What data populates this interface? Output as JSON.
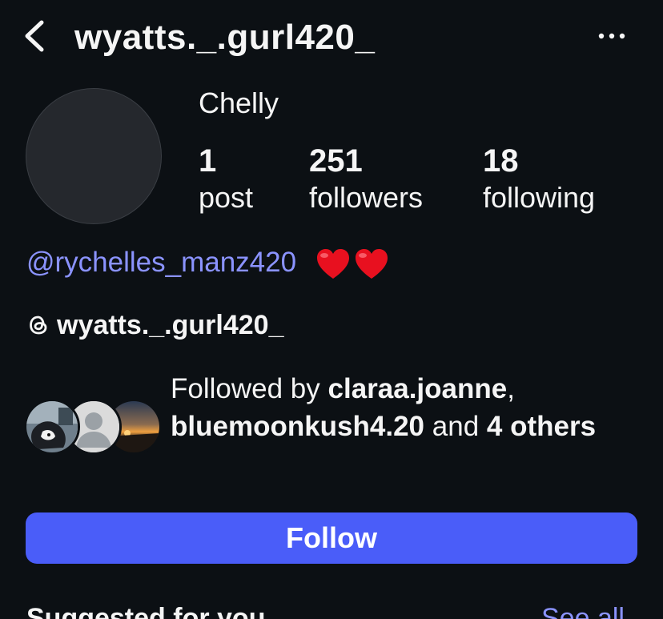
{
  "header": {
    "username": "wyatts._.gurl420_",
    "back_icon": "chevron-left-icon",
    "more_icon": "ellipsis-horizontal-icon"
  },
  "profile": {
    "display_name": "Chelly",
    "stats": [
      {
        "count": "1",
        "label": "post"
      },
      {
        "count": "251",
        "label": "followers"
      },
      {
        "count": "18",
        "label": "following"
      }
    ]
  },
  "bio": {
    "mention": "@rychelles_manz420",
    "mention_color": "#8b93ff",
    "emoji": [
      "❤️",
      "❤️"
    ],
    "threads_icon": "threads-icon",
    "threads_username": "wyatts._.gurl420_"
  },
  "followed_by": {
    "prefix": "Followed by",
    "users": [
      "claraa.joanne",
      "bluemoonkush4.20"
    ],
    "connector": "and",
    "others_count": "4",
    "others_label": "others",
    "avatar_icons": [
      "mutual-avatar-photo",
      "default-avatar-icon",
      "mutual-avatar-sunset"
    ]
  },
  "actions": {
    "follow_label": "Follow",
    "follow_color": "#4a5df9"
  },
  "suggested": {
    "label": "Suggested for you",
    "see_all_label": "See all"
  },
  "theme": {
    "background": "#0c1014",
    "text": "#f5f5f5"
  }
}
